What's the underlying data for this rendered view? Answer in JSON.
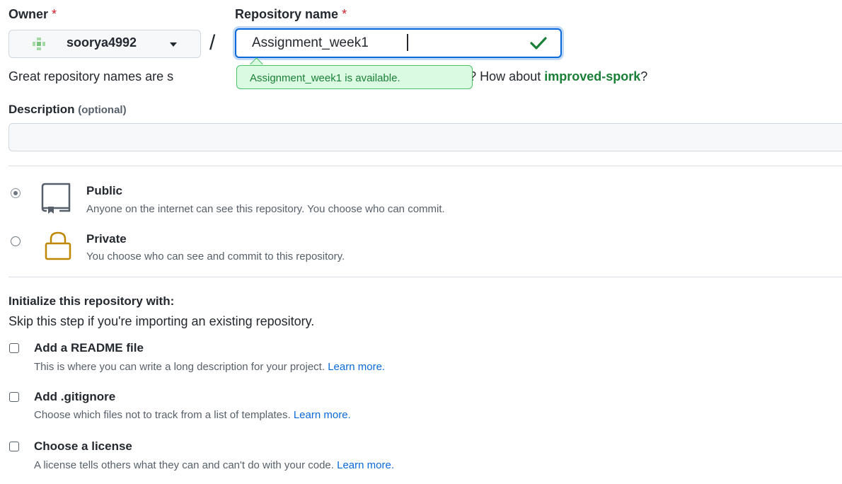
{
  "owner": {
    "label": "Owner",
    "required_mark": "*",
    "value": "soorya4992"
  },
  "repo_name": {
    "label": "Repository name",
    "required_mark": "*",
    "value": "Assignment_week1",
    "separator": "/",
    "availability_tooltip": "Assignment_week1 is available."
  },
  "hint": {
    "text_start": "Great repository names are s",
    "text_end": "nspiration? How about",
    "suggestion": "improved-spork",
    "suffix": "?"
  },
  "description": {
    "label": "Description",
    "optional": "(optional)",
    "value": ""
  },
  "visibility": {
    "options": [
      {
        "title": "Public",
        "desc": "Anyone on the internet can see this repository. You choose who can commit.",
        "selected": true
      },
      {
        "title": "Private",
        "desc": "You choose who can see and commit to this repository.",
        "selected": false
      }
    ]
  },
  "initialize": {
    "title": "Initialize this repository with:",
    "subtitle": "Skip this step if you're importing an existing repository.",
    "options": [
      {
        "title": "Add a README file",
        "desc": "This is where you can write a long description for your project.",
        "link": "Learn more.",
        "checked": false
      },
      {
        "title": "Add .gitignore",
        "desc": "Choose which files not to track from a list of templates.",
        "link": "Learn more.",
        "checked": false
      },
      {
        "title": "Choose a license",
        "desc": "A license tells others what they can and can't do with your code.",
        "link": "Learn more.",
        "checked": false
      }
    ]
  },
  "colors": {
    "accent": "#0969da",
    "success": "#1a7f37",
    "required": "#cf222e",
    "lock_icon": "#bf8700"
  },
  "icons": [
    "repo-icon",
    "lock-icon",
    "check-icon",
    "avatar-icon",
    "caret-down-icon"
  ]
}
